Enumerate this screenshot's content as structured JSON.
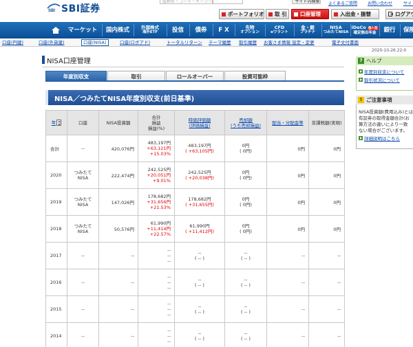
{
  "header": {
    "logo_mark": "SBI",
    "logo_text": "SBI証券",
    "search_placeholder": "銘柄名・コード・キーワード",
    "site_search_button": "サイト内検索",
    "top_links": [
      "よくあるご質問",
      "お問い合わせ",
      "サイトマップ"
    ],
    "top_buttons": [
      {
        "label": "ポートフォリオ"
      },
      {
        "label": "取 引"
      },
      {
        "label": "口座管理",
        "active": true
      },
      {
        "label": "入出金・振替"
      },
      {
        "label": "ログアウト"
      }
    ]
  },
  "nav": {
    "items": [
      {
        "label": "マーケット"
      },
      {
        "label": "国内株式"
      },
      {
        "label": "外国株式",
        "sub": "海外ETF"
      },
      {
        "label": "投信"
      },
      {
        "label": "債券"
      },
      {
        "label": "F X"
      },
      {
        "label": "先物",
        "sub": "オプション"
      },
      {
        "label": "CFD",
        "sub": "eワラント"
      },
      {
        "label": "金・銀",
        "sub": "プラチナ"
      },
      {
        "label": "NISA",
        "sub": "つみたてNISA"
      },
      {
        "label": "iDeCo",
        "sub": "確定拠出年金",
        "badge": "個人型"
      },
      {
        "label": "銀行"
      },
      {
        "label": "保険"
      }
    ]
  },
  "subnav": {
    "items": [
      {
        "label": "口座(円建)"
      },
      {
        "label": "口座(外貨建)"
      },
      {
        "label": "口座(NISA)",
        "active": true
      },
      {
        "label": "口座(ロボアド)"
      },
      {
        "label": "トータルリターン"
      },
      {
        "label": "テーマ履歴"
      },
      {
        "label": "取引履歴"
      },
      {
        "label": "お客さま情報 設定・変更"
      },
      {
        "label": "電子文付書面"
      }
    ]
  },
  "datetime": "2020-10-26 22:0",
  "page_title": "NISA口座管理",
  "tabs": [
    {
      "label": "年度別収支",
      "active": true
    },
    {
      "label": "取引"
    },
    {
      "label": "ロールオーバー"
    },
    {
      "label": "投資可能枠"
    }
  ],
  "section_title": "NISA／つみたてNISA年度別収支(前日基準)",
  "table": {
    "headers": {
      "year": "年",
      "account": "口座",
      "invested": "NISA投資額",
      "total_pl": [
        "合計",
        "損益",
        "損益(%)"
      ],
      "market_value": [
        "時価評価額",
        "(評価損益)"
      ],
      "sold": [
        "売却額",
        "(うち売却損益)"
      ],
      "dividend": "配当・分配金等",
      "tax": "非課税額(実現)"
    },
    "rows": [
      {
        "year": "合計",
        "account": [
          "--"
        ],
        "invested": "420,076円",
        "total": "483,197円",
        "pl": "+63,121円",
        "pct": "+15.03%",
        "mv": "483,197円",
        "mv_pl": "( +63,105円)",
        "sold": "0円",
        "sold_pl": "( 0円)",
        "div": "0円",
        "tax": "0円"
      },
      {
        "year": "2020",
        "account": [
          "つみたて",
          "NISA"
        ],
        "invested": "222,474円",
        "total": "242,525円",
        "pl": "+20,051円",
        "pct": "+9.01%",
        "mv": "242,525円",
        "mv_pl": "( +20,038円)",
        "sold": "0円",
        "sold_pl": "( 0円)",
        "div": "0円",
        "tax": "0円"
      },
      {
        "year": "2019",
        "account": [
          "つみたて",
          "NISA"
        ],
        "invested": "147,026円",
        "total": "178,682円",
        "pl": "+31,656円",
        "pct": "+21.53%",
        "mv": "178,682円",
        "mv_pl": "( +31,655円)",
        "sold": "0円",
        "sold_pl": "( 0円)",
        "div": "0円",
        "tax": "0円"
      },
      {
        "year": "2018",
        "account": [
          "つみたて",
          "NISA"
        ],
        "invested": "50,576円",
        "total": "61,990円",
        "pl": "+11,414円",
        "pct": "+22.57%",
        "mv": "61,990円",
        "mv_pl": "( +11,412円)",
        "sold": "0円",
        "sold_pl": "( 0円)",
        "div": "0円",
        "tax": "0円"
      },
      {
        "year": "2017",
        "account": [
          "--"
        ],
        "invested": "--",
        "total": "--",
        "pl": "--",
        "pct": "--",
        "mv": "--",
        "mv_pl": "( -- )",
        "sold": "--",
        "sold_pl": "( -- )",
        "div": "--",
        "tax": "--"
      },
      {
        "year": "2016",
        "account": [
          "--"
        ],
        "invested": "--",
        "total": "--",
        "pl": "--",
        "pct": "--",
        "mv": "--",
        "mv_pl": "( -- )",
        "sold": "--",
        "sold_pl": "( -- )",
        "div": "--",
        "tax": "--"
      },
      {
        "year": "2015",
        "account": [
          "--"
        ],
        "invested": "--",
        "total": "--",
        "pl": "--",
        "pct": "--",
        "mv": "--",
        "mv_pl": "( -- )",
        "sold": "--",
        "sold_pl": "( -- )",
        "div": "--",
        "tax": "--"
      },
      {
        "year": "2014",
        "account": [
          "--"
        ],
        "invested": "--",
        "total": "--",
        "pl": "--",
        "pct": "--",
        "mv": "--",
        "mv_pl": "( -- )",
        "sold": "--",
        "sold_pl": "( -- )",
        "div": "--",
        "tax": "--"
      }
    ]
  },
  "sidebar": {
    "help_title": "ヘルプ",
    "help_links": [
      "年度別収支について",
      "取引状況について"
    ],
    "notice_title": "ご注意事項",
    "notice_lines": [
      "NISA投資額(費用込み)とは",
      "有証券の取得金額合計(お",
      "算方法の違いにより一致",
      "ない場合がございます。"
    ],
    "notice_link": "詳細説明はこちら"
  },
  "colors": {
    "brand": "#0d4a92",
    "nav": "#1a5fa8",
    "profit": "#e00000",
    "help": "#3f8f2a"
  }
}
